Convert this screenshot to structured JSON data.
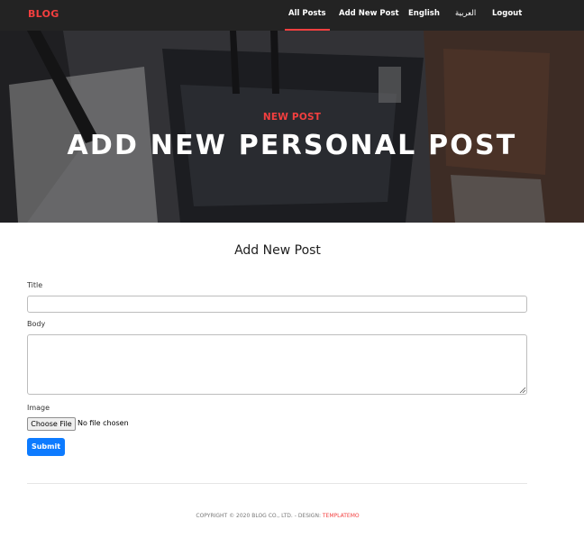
{
  "nav": {
    "brand": "BLOG",
    "items": [
      {
        "label": "All Posts"
      },
      {
        "label": "Add New Post"
      },
      {
        "label": "English"
      },
      {
        "label": "العربية"
      },
      {
        "label": "Logout"
      }
    ]
  },
  "hero": {
    "kicker": "NEW POST",
    "title": "ADD NEW PERSONAL POST"
  },
  "form": {
    "heading": "Add New Post",
    "title_label": "Title",
    "title_value": "",
    "body_label": "Body",
    "body_value": "",
    "image_label": "Image",
    "file_button": "Choose File",
    "file_status": "No file chosen",
    "submit_label": "Submit"
  },
  "footer": {
    "copyright": "COPYRIGHT © 2020 BLOG CO., LTD. - DESIGN: ",
    "credit": "TEMPLATEMO"
  },
  "colors": {
    "accent": "#f33f3f",
    "nav_bg": "#232323",
    "primary_button": "#0d7bff"
  }
}
